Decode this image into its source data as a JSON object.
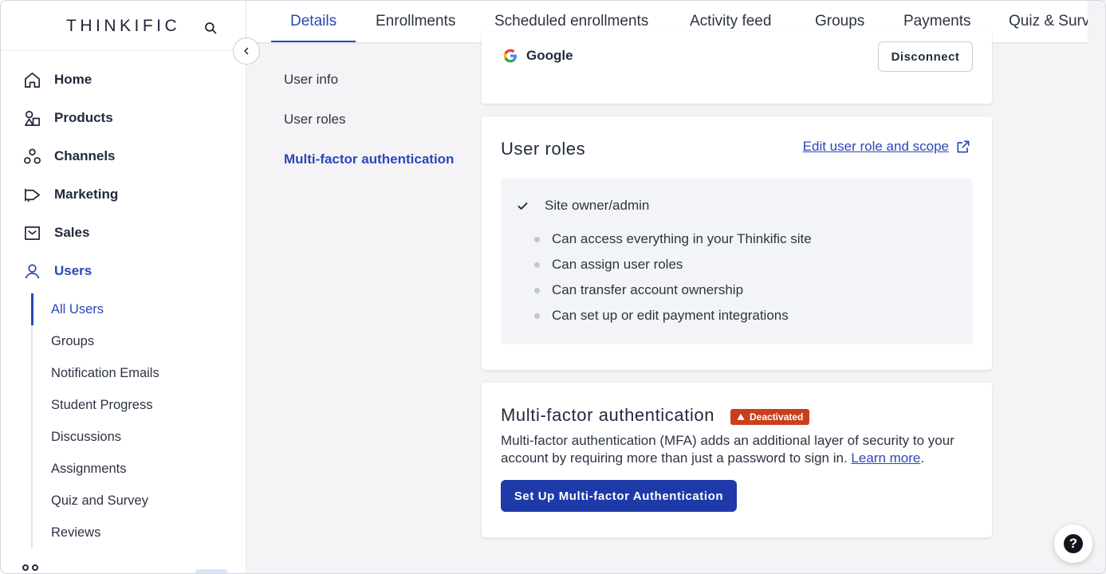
{
  "brand": {
    "logo": "THINKIFIC"
  },
  "nav": {
    "items": [
      {
        "label": "Home",
        "icon": "home-icon"
      },
      {
        "label": "Products",
        "icon": "products-icon"
      },
      {
        "label": "Channels",
        "icon": "channels-icon"
      },
      {
        "label": "Marketing",
        "icon": "marketing-icon"
      },
      {
        "label": "Sales",
        "icon": "sales-icon"
      },
      {
        "label": "Users",
        "icon": "user-icon",
        "active": true
      }
    ],
    "sub_items": [
      {
        "label": "All Users",
        "active": true
      },
      {
        "label": "Groups"
      },
      {
        "label": "Notification Emails"
      },
      {
        "label": "Student Progress"
      },
      {
        "label": "Discussions"
      },
      {
        "label": "Assignments"
      },
      {
        "label": "Quiz and Survey"
      },
      {
        "label": "Reviews"
      }
    ]
  },
  "tabs": [
    {
      "label": "Details",
      "active": true
    },
    {
      "label": "Enrollments"
    },
    {
      "label": "Scheduled enrollments"
    },
    {
      "label": "Activity feed"
    },
    {
      "label": "Groups"
    },
    {
      "label": "Payments"
    },
    {
      "label": "Quiz & Surv"
    }
  ],
  "inner_nav": [
    {
      "label": "User info"
    },
    {
      "label": "User roles"
    },
    {
      "label": "Multi-factor authentication",
      "active": true
    }
  ],
  "integration": {
    "name": "Google",
    "disconnect_label": "Disconnect"
  },
  "user_roles": {
    "title": "User roles",
    "edit_link": "Edit user role and scope",
    "role_name": "Site owner/admin",
    "permissions": [
      "Can access everything in your Thinkific site",
      "Can assign user roles",
      "Can transfer account ownership",
      "Can set up or edit payment integrations"
    ]
  },
  "mfa": {
    "title": "Multi-factor authentication",
    "status_badge": "Deactivated",
    "description": "Multi-factor authentication (MFA) adds an additional layer of security to your account by requiring more than just a password to sign in.",
    "learn_more": "Learn more",
    "period": ".",
    "button_label": "Set Up Multi-factor Authentication"
  },
  "help": {
    "label": "?"
  },
  "colors": {
    "accent": "#2b47b8",
    "primary_button": "#1e3aa8",
    "warning_badge": "#c8401b"
  }
}
